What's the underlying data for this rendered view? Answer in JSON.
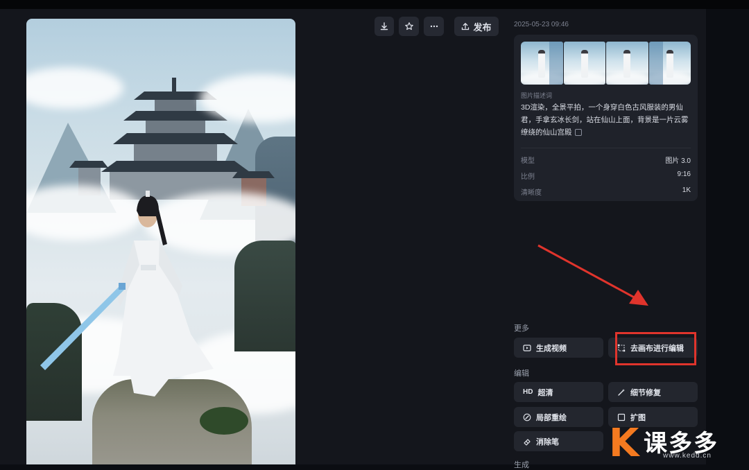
{
  "toolbar": {
    "download_icon": "download-icon",
    "favorite_icon": "star-icon",
    "more_icon": "more-icon",
    "publish_label": "发布"
  },
  "timestamp": "2025-05-23 09:46",
  "info": {
    "description_label": "图片描述词",
    "description_text": "3D渲染，全景平拍，一个身穿白色古风服装的男仙君，手拿玄冰长剑，站在仙山上面，背景是一片云雾缭绕的仙山宫殿",
    "meta": [
      {
        "key": "模型",
        "value": "图片 3.0"
      },
      {
        "key": "比例",
        "value": "9:16"
      },
      {
        "key": "清晰度",
        "value": "1K"
      }
    ]
  },
  "sections": {
    "more_title": "更多",
    "edit_title": "编辑",
    "next_title": "生成"
  },
  "actions": {
    "generate_video": "生成视频",
    "edit_on_canvas": "去画布进行编辑",
    "hd_tag": "HD",
    "upscale": "超清",
    "detail_repair": "细节修复",
    "inpaint": "局部重绘",
    "expand": "扩图",
    "eraser": "消除笔"
  },
  "watermark": {
    "logo_letter": "K",
    "text": "课多多",
    "url": "www.kedd.cn"
  },
  "colors": {
    "background": "#14161c",
    "card": "#1f222a",
    "button": "#23262e",
    "annotation_red": "#e0342c",
    "brand_orange": "#f47a20"
  }
}
